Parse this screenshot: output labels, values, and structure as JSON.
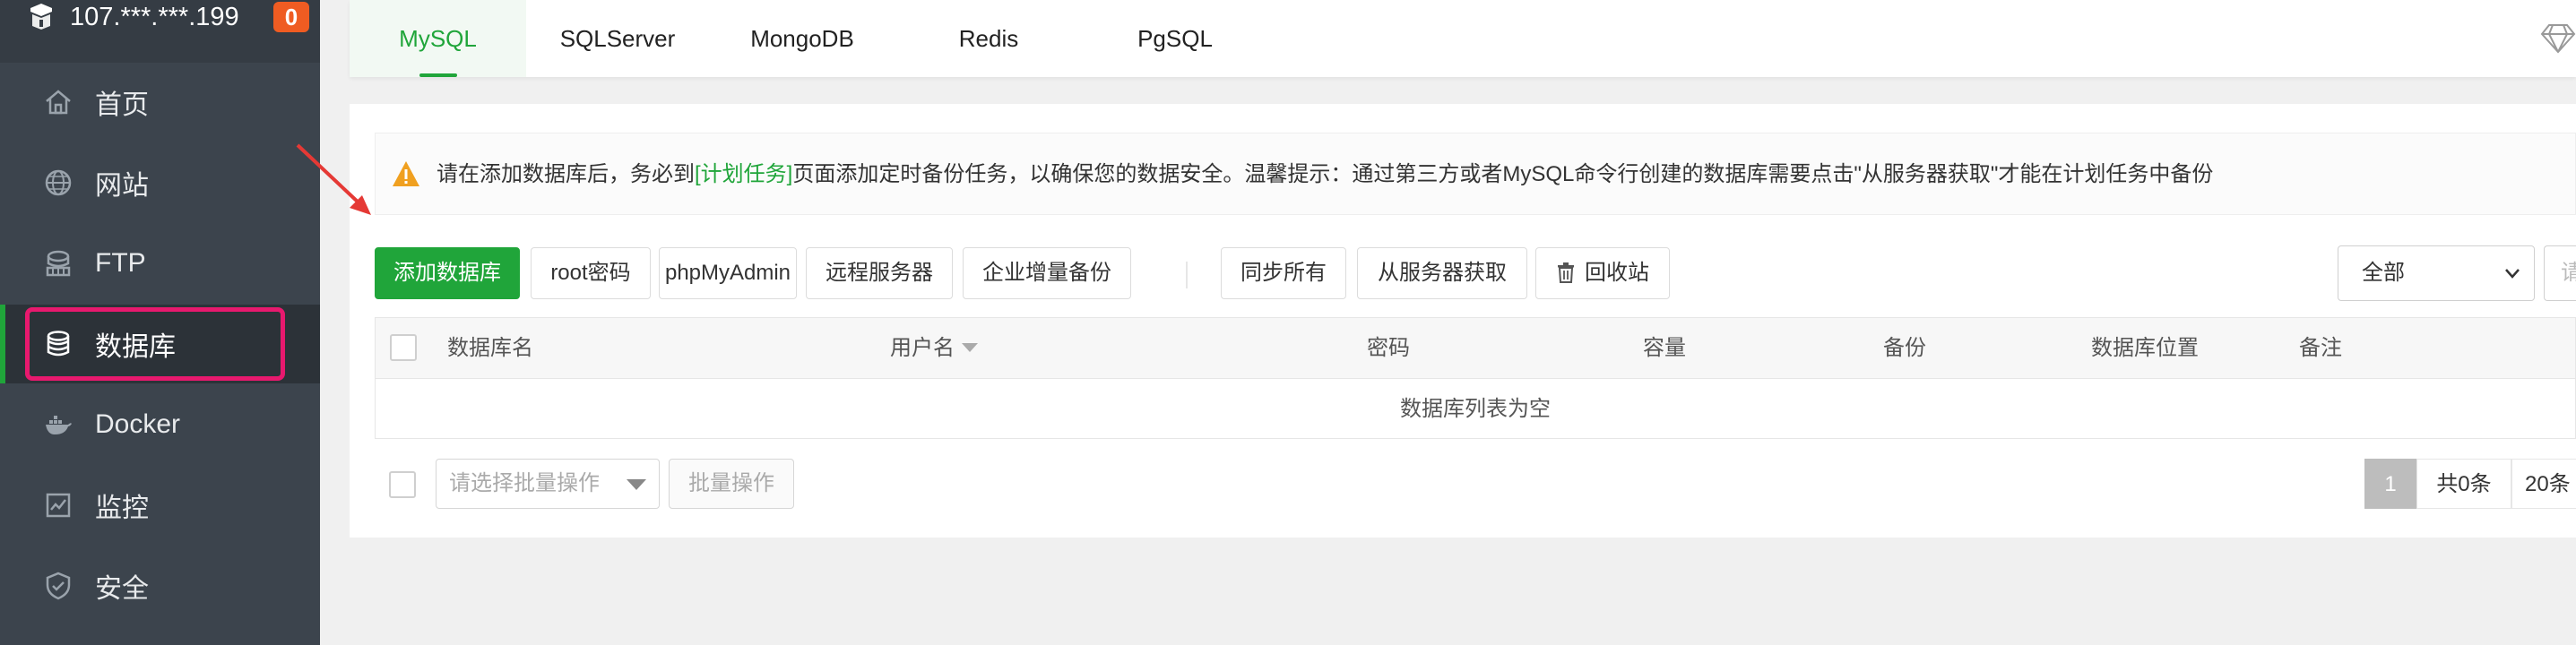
{
  "sidebar": {
    "host_ip": "107.***.***.199",
    "badge": "0",
    "items": [
      {
        "label": "首页",
        "icon": "home-icon"
      },
      {
        "label": "网站",
        "icon": "globe-icon"
      },
      {
        "label": "FTP",
        "icon": "ftp-icon"
      },
      {
        "label": "数据库",
        "icon": "database-icon",
        "active": true
      },
      {
        "label": "Docker",
        "icon": "docker-icon"
      },
      {
        "label": "监控",
        "icon": "monitor-icon"
      },
      {
        "label": "安全",
        "icon": "shield-icon"
      }
    ]
  },
  "tabs": [
    {
      "label": "MySQL",
      "active": true
    },
    {
      "label": "SQLServer"
    },
    {
      "label": "MongoDB"
    },
    {
      "label": "Redis"
    },
    {
      "label": "PgSQL"
    }
  ],
  "notice": {
    "before": "请在添加数据库后，务必到",
    "link": "[计划任务]",
    "after": "页面添加定时备份任务，以确保您的数据安全。温馨提示：通过第三方或者MySQL命令行创建的数据库需要点击\"从服务器获取\"才能在计划任务中备份"
  },
  "toolbar": {
    "add_db": "添加数据库",
    "root_pwd": "root密码",
    "phpmyadmin": "phpMyAdmin",
    "remote_server": "远程服务器",
    "enterprise_backup": "企业增量备份",
    "sync_all": "同步所有",
    "fetch_from_server": "从服务器获取",
    "recycle_bin": "回收站",
    "filter_value": "全部",
    "search_placeholder": "请"
  },
  "table": {
    "headers": [
      "数据库名",
      "用户名",
      "密码",
      "容量",
      "备份",
      "数据库位置",
      "备注"
    ],
    "empty_text": "数据库列表为空"
  },
  "footer": {
    "batch_placeholder": "请选择批量操作",
    "batch_button": "批量操作",
    "current_page": "1",
    "total": "共0条",
    "per_page": "20条"
  },
  "colors": {
    "accent": "#20a53a",
    "sidebar_bg": "#3c444d",
    "highlight_box": "#e8196e",
    "badge": "#ef5c22",
    "arrow": "#e53935"
  }
}
